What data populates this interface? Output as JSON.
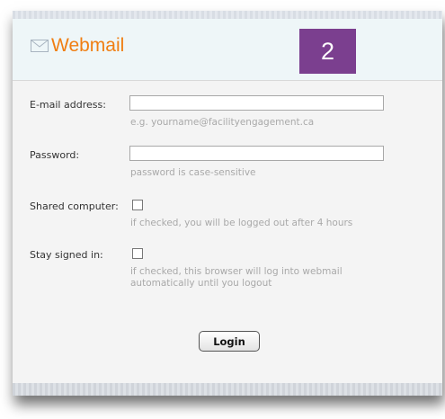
{
  "header": {
    "logo_text": "Webmail",
    "logo_icon": "envelope-icon",
    "badge": "2"
  },
  "form": {
    "email": {
      "label": "E-mail address:",
      "value": "",
      "hint": "e.g. yourname@facilityengagement.ca"
    },
    "password": {
      "label": "Password:",
      "value": "",
      "hint": "password is case-sensitive"
    },
    "shared": {
      "label": "Shared computer:",
      "checked": false,
      "hint": "if checked, you will be logged out after 4 hours"
    },
    "stay": {
      "label": "Stay signed in:",
      "checked": false,
      "hint_line1": "if checked, this browser will log into webmail",
      "hint_line2": "automatically until you logout"
    },
    "login_label": "Login"
  },
  "colors": {
    "logo": "#f07e12",
    "badge": "#7b3f8f",
    "header_bg": "#eef6f8"
  }
}
